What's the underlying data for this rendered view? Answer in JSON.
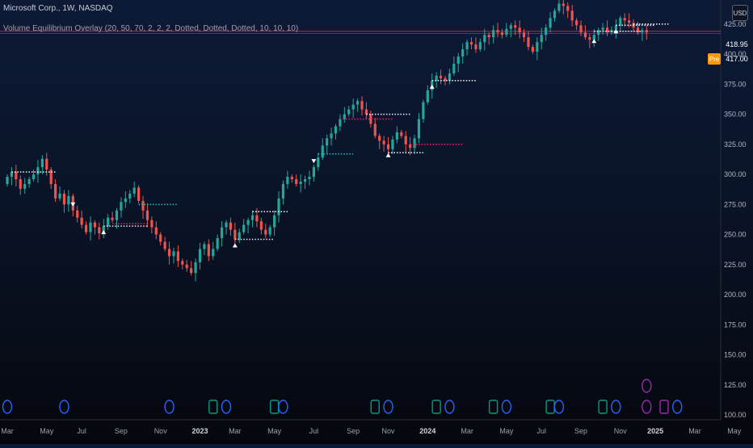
{
  "header": {
    "symbol_line": "Microsoft Corp., 1W, NASDAQ",
    "indicator_line": "Volume Equilibrium Overlay (20, 50, 70, 2, 2, 2, Dotted, Dotted, Dotted, 10, 10, 10)"
  },
  "price_scale": {
    "currency": "USD",
    "last_price": "418.95",
    "pre_label": "Pre",
    "pre_price": "417.00"
  },
  "colors": {
    "up": "#26a69a",
    "down": "#ef5350",
    "level_white": "#e8eaf0",
    "level_cyan": "#2cb5c0",
    "level_pink": "#e91e63",
    "event_dividend": "#2962ff",
    "event_earnings": "#089981",
    "event_split": "#9c27b0",
    "pre_tag": "#ff9800",
    "last_tag": "#ef5350"
  },
  "chart_data": {
    "type": "candlestick",
    "title": "Microsoft Corp., 1W, NASDAQ",
    "y_ticks": [
      "425.00",
      "400.00",
      "375.00",
      "350.00",
      "325.00",
      "300.00",
      "275.00",
      "250.00",
      "225.00",
      "200.00",
      "175.00",
      "150.00",
      "125.00",
      "100.00"
    ],
    "y_tick_values": [
      425,
      400,
      375,
      350,
      325,
      300,
      275,
      250,
      225,
      200,
      175,
      150,
      125,
      100
    ],
    "ylim": [
      96,
      445
    ],
    "x_ticks": [
      "Mar",
      "May",
      "Jul",
      "Sep",
      "Nov",
      "2023",
      "Mar",
      "May",
      "Jul",
      "Sep",
      "Nov",
      "2024",
      "Mar",
      "May",
      "Jul",
      "Sep",
      "Nov",
      "2025",
      "Mar",
      "May"
    ],
    "x_tick_weeks": [
      0,
      9,
      17,
      26,
      35,
      44,
      52,
      61,
      70,
      79,
      87,
      96,
      105,
      114,
      122,
      131,
      140,
      148,
      157,
      166
    ],
    "bold_ticks": [
      "2023",
      "2024",
      "2025"
    ],
    "candles_close": [
      298,
      302,
      296,
      288,
      292,
      296,
      300,
      306,
      313,
      304,
      292,
      280,
      284,
      275,
      282,
      270,
      264,
      258,
      252,
      260,
      256,
      251,
      257,
      264,
      262,
      270,
      277,
      280,
      284,
      289,
      278,
      270,
      262,
      256,
      250,
      244,
      238,
      232,
      236,
      228,
      225,
      222,
      218,
      227,
      238,
      242,
      232,
      238,
      247,
      256,
      260,
      254,
      246,
      252,
      258,
      262,
      266,
      261,
      254,
      250,
      256,
      266,
      280,
      292,
      298,
      296,
      292,
      294,
      296,
      298,
      306,
      314,
      324,
      330,
      334,
      340,
      346,
      350,
      354,
      358,
      361,
      354,
      350,
      342,
      332,
      328,
      325,
      321,
      329,
      335,
      332,
      325,
      322,
      330,
      346,
      360,
      370,
      378,
      382,
      380,
      378,
      384,
      392,
      398,
      404,
      410,
      408,
      404,
      410,
      416,
      414,
      420,
      418,
      416,
      421,
      424,
      422,
      418,
      414,
      406,
      402,
      410,
      416,
      422,
      430,
      436,
      442,
      440,
      436,
      428,
      424,
      418,
      414,
      412,
      416,
      420,
      422,
      418,
      420,
      424,
      430,
      428,
      426,
      422,
      418,
      420,
      418
    ],
    "open_price": 292,
    "grid": false,
    "last_price": 418.95,
    "pre_price": 417.0
  }
}
